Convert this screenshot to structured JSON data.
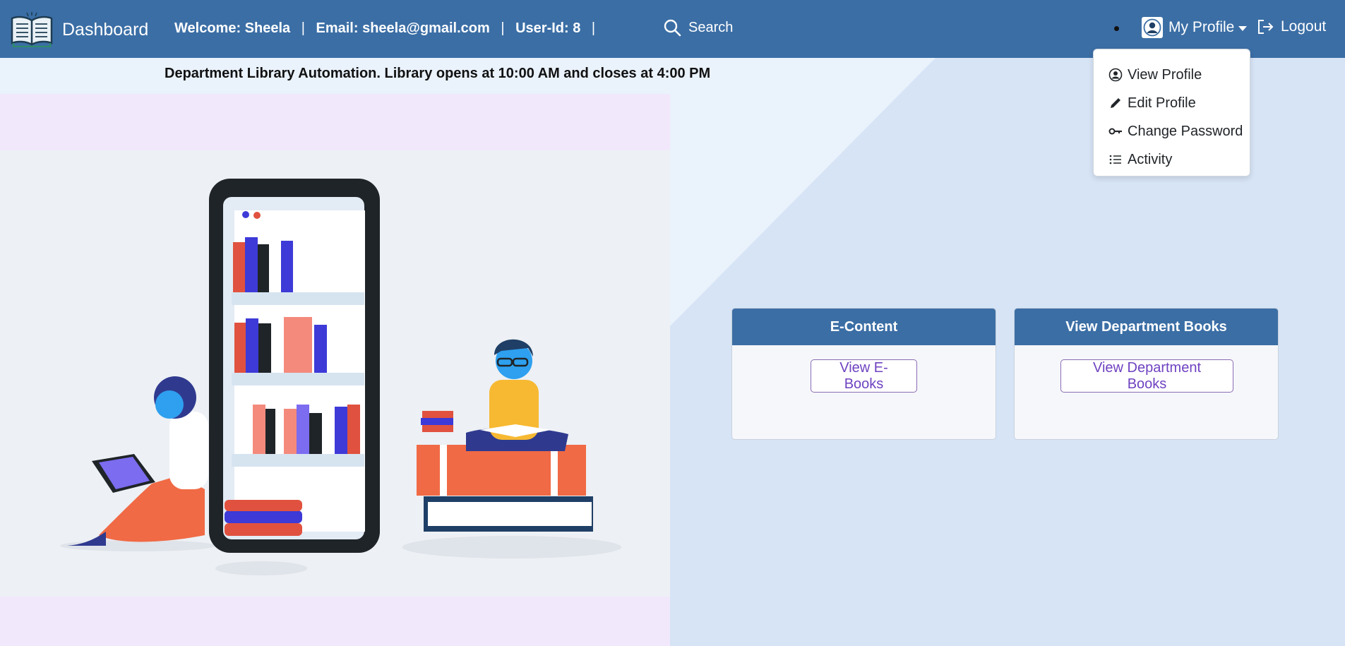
{
  "navbar": {
    "brand_icon": "open-book-icon",
    "brand": "Dashboard",
    "welcome_label": "Welcome:",
    "welcome_name": "Sheela",
    "email_label": "Email:",
    "email": "sheela@gmail.com",
    "userid_label": "User-Id:",
    "userid": "8",
    "separator": "|",
    "search_label": "Search",
    "search_icon": "search-icon",
    "profile_label": "My Profile",
    "profile_icon": "user-circle-icon",
    "logout_label": "Logout",
    "logout_icon": "logout-icon",
    "color": "#3b6ea5"
  },
  "announcement": "Department Library Automation. Library opens at 10:00 AM and closes at 4:00 PM",
  "dropdown": {
    "items": [
      {
        "label": "View Profile",
        "icon": "user-circle-icon"
      },
      {
        "label": "Edit Profile",
        "icon": "pencil-icon"
      },
      {
        "label": "Change Password",
        "icon": "key-icon"
      },
      {
        "label": "Activity",
        "icon": "list-icon"
      }
    ]
  },
  "cards": [
    {
      "title": "E-Content",
      "button": "View E-Books"
    },
    {
      "title": "View Department Books",
      "button": "View Department Books"
    }
  ],
  "colors": {
    "accent": "#3b6ea5",
    "button_text": "#6f42c1",
    "background": "#d6e4f6",
    "illustration_bg": "#f1e8fb"
  }
}
